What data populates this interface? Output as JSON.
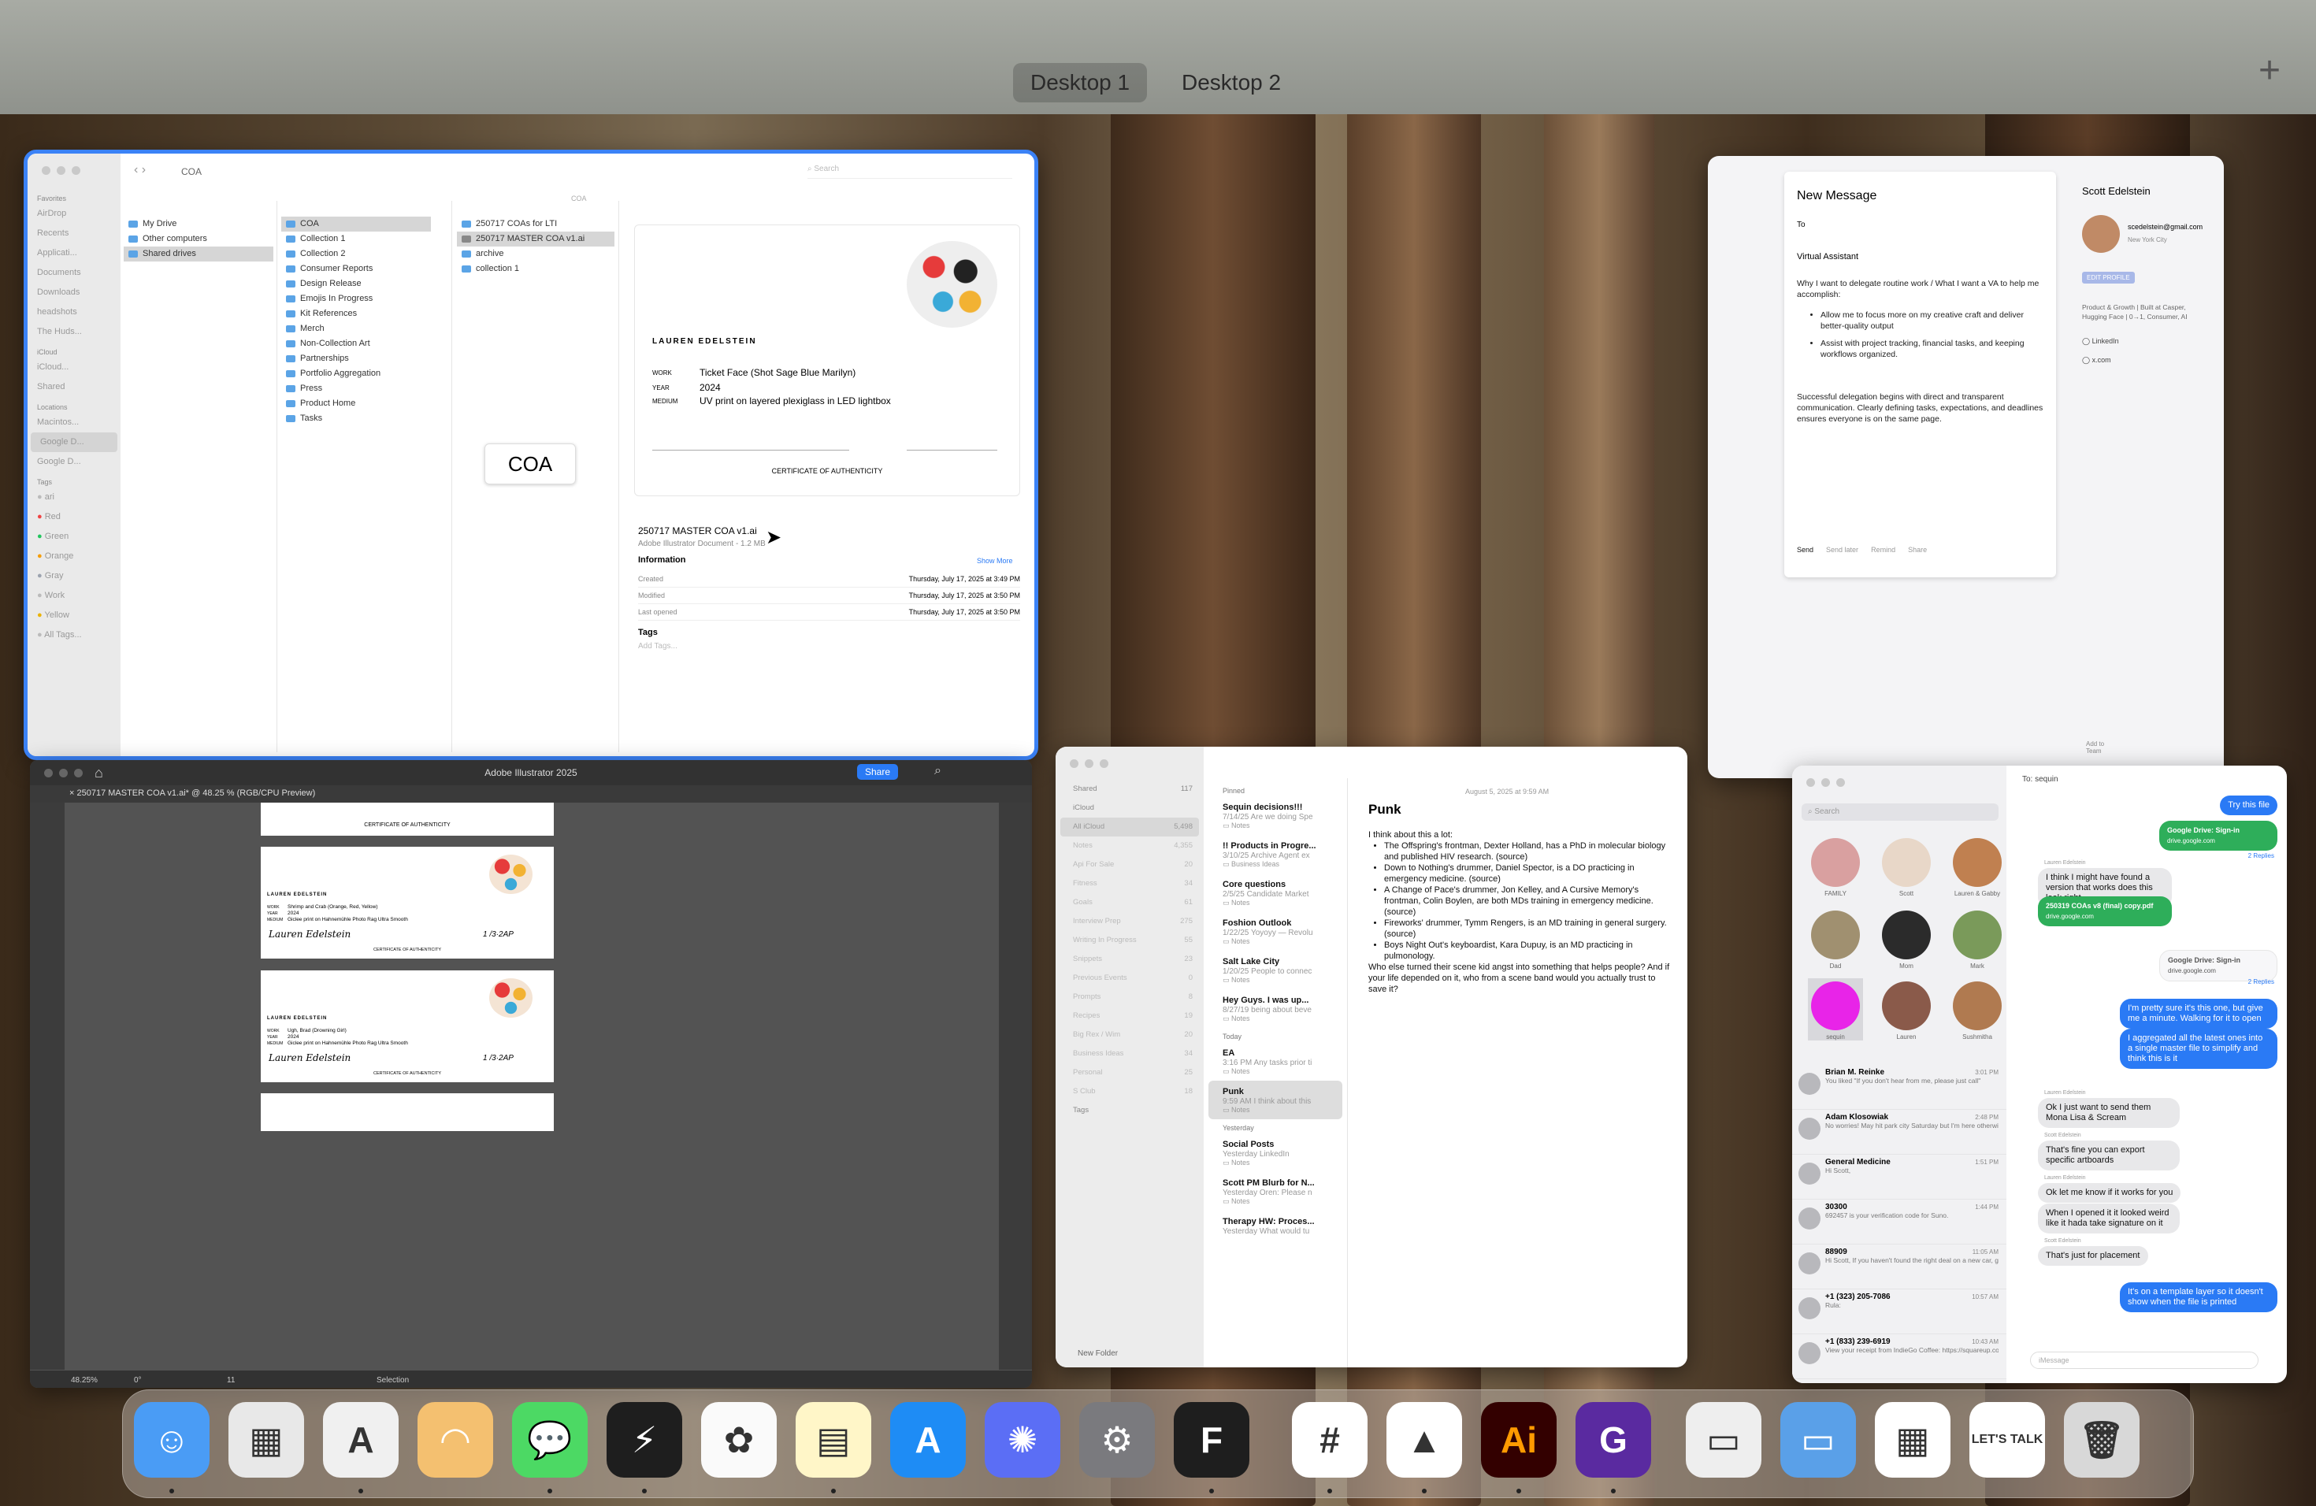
{
  "desktops": {
    "d1": "Desktop 1",
    "d2": "Desktop 2"
  },
  "finder": {
    "path": "COA",
    "search_placeholder": "Search",
    "column_header": "COA",
    "sidebar_favorites_header": "Favorites",
    "favorites": [
      "AirDrop",
      "Recents",
      "Applicati...",
      "Documents",
      "Downloads",
      "headshots",
      "The Huds..."
    ],
    "icloud_header": "iCloud",
    "icloud": [
      "iCloud...",
      "Shared"
    ],
    "locations_header": "Locations",
    "locations": [
      "Macintos...",
      "Google D...",
      "Google D..."
    ],
    "tags_header": "Tags",
    "tags": [
      "ari",
      "Red",
      "Green",
      "Orange",
      "Gray",
      "Work",
      "Yellow",
      "All Tags..."
    ],
    "col1": [
      "My Drive",
      "Other computers",
      "Shared drives"
    ],
    "col2": [
      "COA",
      "Collection 1",
      "Collection 2",
      "Consumer Reports",
      "Design Release",
      "Emojis In Progress",
      "Kit References",
      "Merch",
      "Non-Collection Art",
      "Partnerships",
      "Portfolio Aggregation",
      "Press",
      "Product Home",
      "Tasks"
    ],
    "col3": [
      "250717 COAs for LTI",
      "250717 MASTER COA v1.ai",
      "archive",
      "collection 1"
    ],
    "preview_label": "COA",
    "cert_name": "LAUREN EDELSTEIN",
    "cert_work_label": "WORK",
    "cert_work_value": "Ticket Face (Shot Sage Blue Marilyn)",
    "cert_year_label": "YEAR",
    "cert_year_value": "2024",
    "cert_medium_label": "MEDIUM",
    "cert_medium_value": "UV print on layered plexiglass in LED lightbox",
    "cert_footer": "CERTIFICATE OF AUTHENTICITY",
    "file_name": "250717 MASTER COA v1.ai",
    "file_kind": "Adobe Illustrator Document - 1.2 MB",
    "info_header": "Information",
    "show_more": "Show More",
    "info": [
      {
        "label": "Created",
        "value": "Thursday, July 17, 2025 at 3:49 PM"
      },
      {
        "label": "Modified",
        "value": "Thursday, July 17, 2025 at 3:50 PM"
      },
      {
        "label": "Last opened",
        "value": "Thursday, July 17, 2025 at 3:50 PM"
      }
    ],
    "tags_title": "Tags",
    "add_tags": "Add Tags..."
  },
  "illustrator": {
    "app_title": "Adobe Illustrator 2025",
    "share": "Share",
    "doc_tab": "250717 MASTER COA v1.ai* @ 48.25 % (RGB/CPU Preview)",
    "zoom": "48.25%",
    "rotate": "0°",
    "page": "11",
    "tool_status": "Selection",
    "cards": [
      {
        "name": "LAUREN EDELSTEIN",
        "work": "Shrimp and Crab (Orange, Red, Yellow)",
        "year": "2024",
        "medium": "Giclee print on Hahnemühle Photo Rag Ultra Smooth",
        "sig": "Lauren Edelstein",
        "ed": "1 /3·2AP",
        "footer": "CERTIFICATE OF AUTHENTICITY"
      },
      {
        "name": "LAUREN EDELSTEIN",
        "work": "Ugh, Brad (Drowning Girl)",
        "year": "2024",
        "medium": "Giclee print on Hahnemühle Photo Rag Ultra Smooth",
        "sig": "Lauren Edelstein",
        "ed": "1 /3·2AP",
        "footer": "CERTIFICATE OF AUTHENTICITY"
      }
    ],
    "top_card_footer": "CERTIFICATE OF AUTHENTICITY",
    "labels": {
      "work": "WORK",
      "year": "YEAR",
      "medium": "MEDIUM"
    }
  },
  "mail": {
    "title": "New Message",
    "to_label": "To",
    "subject": "Virtual Assistant",
    "body_intro": "Why I want to delegate routine work / What I want a VA to help me accomplish:",
    "bullets": [
      "Allow me to focus more on my creative craft and deliver better-quality output",
      "Assist with project tracking, financial tasks, and keeping workflows organized."
    ],
    "para": "Successful delegation begins with direct and transparent communication. Clearly defining tasks, expectations, and deadlines ensures everyone is on the same page.",
    "actions": [
      "Send",
      "Send later",
      "Remind",
      "Share"
    ],
    "contact_name": "Scott Edelstein",
    "contact_email": "scedelstein@gmail.com",
    "contact_location": "New York City",
    "edit_profile": "EDIT PROFILE",
    "contact_bio": "Product & Growth | Built at Casper, Hugging Face | 0→1, Consumer, AI",
    "links": [
      "LinkedIn",
      "x.com"
    ],
    "add_to_team": "Add to Team"
  },
  "notes": {
    "date": "August 5, 2025 at 9:59 AM",
    "sidebar": [
      {
        "label": "Shared",
        "count": "117"
      },
      {
        "label": "iCloud",
        "count": ""
      },
      {
        "label": "All iCloud",
        "count": "5,498"
      },
      {
        "label": "Notes",
        "count": "4,355"
      },
      {
        "label": "Api For Sale",
        "count": "20"
      },
      {
        "label": "Fitness",
        "count": "34"
      },
      {
        "label": "Goals",
        "count": "61"
      },
      {
        "label": "Interview Prep",
        "count": "275"
      },
      {
        "label": "Writing In Progress",
        "count": "55"
      },
      {
        "label": "Snippets",
        "count": "23"
      },
      {
        "label": "Previous Events",
        "count": "0"
      },
      {
        "label": "Prompts",
        "count": "8"
      },
      {
        "label": "Recipes",
        "count": "19"
      },
      {
        "label": "Big Rex / Wim",
        "count": "20"
      },
      {
        "label": "Business Ideas",
        "count": "34"
      },
      {
        "label": "Personal",
        "count": "25"
      },
      {
        "label": "S Club",
        "count": "18"
      },
      {
        "label": "Tags",
        "count": ""
      }
    ],
    "new_folder": "New Folder",
    "pinned_header": "Pinned",
    "pinned": [
      {
        "title": "Sequin decisions!!!",
        "date": "7/14/25",
        "preview": "Are we doing Spe",
        "folder": "Notes"
      },
      {
        "title": "!! Products in Progre...",
        "date": "3/10/25",
        "preview": "Archive Agent ex",
        "folder": "Business Ideas"
      },
      {
        "title": "Core questions",
        "date": "2/5/25",
        "preview": "Candidate Market",
        "folder": "Notes"
      },
      {
        "title": "Foshion Outlook",
        "date": "1/22/25",
        "preview": "Yoyoyy — Revolu",
        "folder": "Notes"
      },
      {
        "title": "Salt Lake City",
        "date": "1/20/25",
        "preview": "People to connec",
        "folder": "Notes"
      },
      {
        "title": "Hey Guys. I was up...",
        "date": "8/27/19",
        "preview": "being about beve",
        "folder": "Notes"
      }
    ],
    "today_header": "Today",
    "today": [
      {
        "title": "EA",
        "date": "3:16 PM",
        "preview": "Any tasks prior ti",
        "folder": "Notes"
      },
      {
        "title": "Punk",
        "date": "9:59 AM",
        "preview": "I think about this",
        "folder": "Notes"
      }
    ],
    "yesterday_header": "Yesterday",
    "yesterday": [
      {
        "title": "Social Posts",
        "date": "Yesterday",
        "preview": "LinkedIn",
        "folder": "Notes"
      },
      {
        "title": "Scott PM Blurb for N...",
        "date": "Yesterday",
        "preview": "Oren: Please n",
        "folder": "Notes"
      },
      {
        "title": "Therapy HW: Proces...",
        "date": "Yesterday",
        "preview": "What would tu",
        "folder": ""
      }
    ],
    "note_title": "Punk",
    "note_intro": "I think about this a lot:",
    "note_bullets": [
      "The Offspring's frontman, Dexter Holland, has a PhD in molecular biology and published HIV research. (source)",
      "Down to Nothing's drummer, Daniel Spector, is a DO practicing in emergency medicine. (source)",
      "A Change of Pace's drummer, Jon Kelley, and A Cursive Memory's frontman, Colin Boylen, are both MDs training in emergency medicine. (source)",
      "Fireworks' drummer, Tymm Rengers, is an MD training in general surgery. (source)",
      "Boys Night Out's keyboardist, Kara Dupuy, is an MD practicing in pulmonology."
    ],
    "note_end": "Who else turned their scene kid angst into something that helps people? And if your life depended on it, who from a scene band would you actually trust to save it?"
  },
  "messages": {
    "search_placeholder": "Search",
    "to_label": "To:",
    "to_value": "sequin",
    "pinned": [
      "FAMILY",
      "Scott",
      "Lauren & Gabby",
      "Dad",
      "Mom",
      "Mark",
      "sequin",
      "Lauren",
      "Sushmitha"
    ],
    "convos": [
      {
        "name": "Brian M. Reinke",
        "time": "3:01 PM",
        "preview": "You liked \"If you don't hear from me, please just call\""
      },
      {
        "name": "Adam Klosowiak",
        "time": "2:48 PM",
        "preview": "No worries! May hit park city Saturday but I'm here otherwise. Let's link up"
      },
      {
        "name": "General Medicine",
        "time": "1:51 PM",
        "preview": "Hi Scott,"
      },
      {
        "name": "30300",
        "time": "1:44 PM",
        "preview": "692457 is your verification code for Suno."
      },
      {
        "name": "88909",
        "time": "11:05 AM",
        "preview": "Hi Scott, If you haven't found the right deal on a new car, get pre-qualified for..."
      },
      {
        "name": "+1 (323) 205-7086",
        "time": "10:57 AM",
        "preview": "Rula:"
      },
      {
        "name": "+1 (833) 239-6919",
        "time": "10:43 AM",
        "preview": "View your receipt from IndieGo Coffee: https://squareup.com/r/r1B9dc7d44e515"
      }
    ],
    "thread": {
      "try_file": "Try this file",
      "gdrive_title": "Google Drive: Sign-in",
      "gdrive_url": "drive.google.com",
      "replies2": "2 Replies",
      "lauren": "Lauren Edelstein",
      "scott": "Scott Edelstein",
      "m1": "I think I might have found a version that works does this look right",
      "m1_file": "250319 COAs v8 (final) copy.pdf",
      "m1_url": "drive.google.com",
      "gdrive2_title": "Google Drive: Sign-in",
      "gdrive2_url": "drive.google.com",
      "replies2b": "2 Replies",
      "m2": "I'm pretty sure it's this one, but give me a minute. Walking for it to open",
      "m3": "I aggregated all the latest ones into a single master file to simplify and think this is it",
      "m4": "Ok I just want to send them Mona Lisa & Scream",
      "m5": "That's fine you can export specific artboards",
      "m6": "Ok let me know if it works for you",
      "m7": "When I opened it it looked weird like it hada take signature on it",
      "m8": "That's just for placement",
      "m9": "It's on a template layer so it doesn't show when the file is printed",
      "input_placeholder": "iMessage"
    }
  },
  "dock": {
    "apps": [
      "Finder",
      "Launchpad",
      "Arc",
      "Safari",
      "Messages",
      "Linear",
      "Photos",
      "Notes",
      "App Store",
      "Perplexity",
      "System Settings",
      "Figma",
      "Slack",
      "Google Drive",
      "Ai",
      "Grammarly",
      "Documents",
      "Folder",
      "Spreadsheet",
      "LET'S TALK",
      "Trash"
    ],
    "ai_label": "Ai",
    "lets_talk": "LET'S TALK"
  },
  "colors": {
    "accent_blue": "#2a7af5",
    "ai_orange": "#ff9a00",
    "sequin_pink": "#e824e8"
  }
}
